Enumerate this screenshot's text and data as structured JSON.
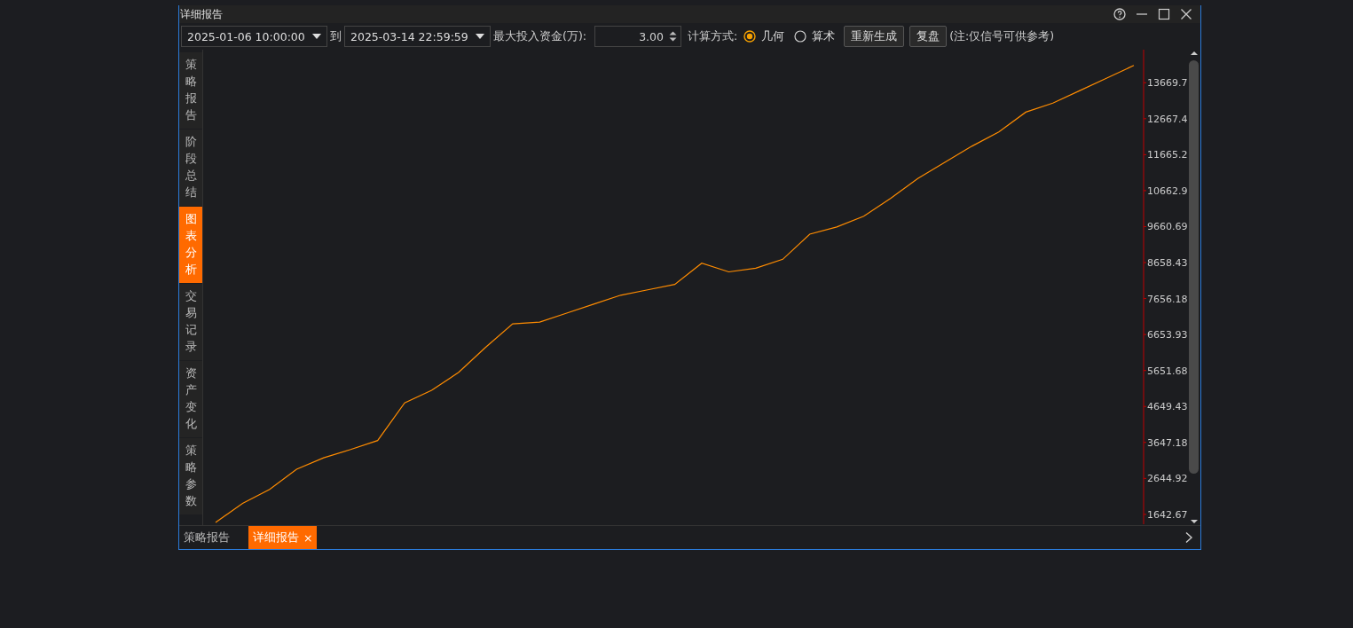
{
  "window": {
    "title": "详细报告"
  },
  "toolbar": {
    "start_time": "2025-01-06 10:00:00",
    "to_label": "到",
    "end_time": "2025-03-14 22:59:59",
    "capital_label": "最大投入资金(万):",
    "capital_value": "3.00",
    "method_label": "计算方式:",
    "methods": [
      {
        "label": "几何",
        "selected": true
      },
      {
        "label": "算术",
        "selected": false
      }
    ],
    "buttons": [
      "重新生成",
      "复盘"
    ],
    "note": "(注:仅信号可供参考)"
  },
  "sidebar": {
    "items": [
      {
        "label": "策略报告",
        "selected": false
      },
      {
        "label": "阶段总结",
        "selected": false
      },
      {
        "label": "图表分析",
        "selected": true
      },
      {
        "label": "交易记录",
        "selected": false
      },
      {
        "label": "资产变化",
        "selected": false
      },
      {
        "label": "策略参数",
        "selected": false
      }
    ]
  },
  "chart_data": {
    "type": "line",
    "ylim": [
      1369,
      14590
    ],
    "yticks": [
      1642.67,
      2644.92,
      3647.18,
      4649.43,
      5651.68,
      6653.93,
      7656.18,
      8658.43,
      9660.69,
      10662.9,
      11665.2,
      12667.4,
      13669.7
    ],
    "series": [
      {
        "color": "#ff8c00",
        "values": [
          1420,
          1950,
          2340,
          2900,
          3220,
          3450,
          3700,
          4750,
          5100,
          5600,
          6300,
          6950,
          7000,
          7250,
          7500,
          7750,
          7900,
          8050,
          8640,
          8400,
          8500,
          8750,
          9450,
          9650,
          9950,
          10450,
          11000,
          11450,
          11900,
          12300,
          12850,
          13100,
          13450,
          13800,
          14150
        ]
      }
    ]
  },
  "bottom_tabs": [
    {
      "label": "策略报告",
      "selected": false
    },
    {
      "label": "详细报告",
      "selected": true,
      "close": "×"
    }
  ]
}
